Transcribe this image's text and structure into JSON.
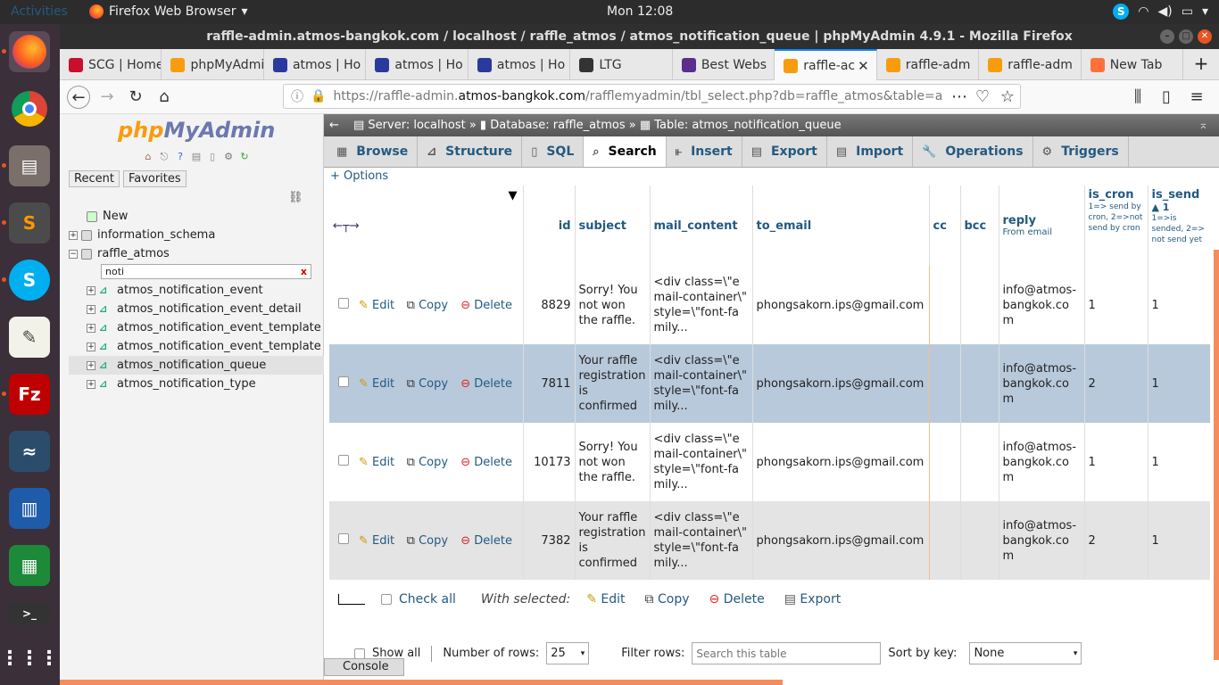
{
  "topbar": {
    "activities": "Activities",
    "app": "Firefox Web Browser",
    "clock": "Mon 12:08"
  },
  "window": {
    "title": "raffle-admin.atmos-bangkok.com / localhost / raffle_atmos / atmos_notification_queue | phpMyAdmin 4.9.1 - Mozilla Firefox"
  },
  "tabs": [
    {
      "label": "SCG | Home",
      "icon": "scg-icon",
      "color": "#c8102e"
    },
    {
      "label": "phpMyAdmin",
      "icon": "pma-icon",
      "color": "#f89c0e"
    },
    {
      "label": "atmos | Ho",
      "icon": "atmos-icon",
      "color": "#2a3a9c"
    },
    {
      "label": "atmos | Ho",
      "icon": "atmos-icon",
      "color": "#2a3a9c"
    },
    {
      "label": "atmos | Ho",
      "icon": "atmos-icon",
      "color": "#2a3a9c"
    },
    {
      "label": "LTG",
      "icon": "ltg-icon",
      "color": "#333"
    },
    {
      "label": "Best Webs",
      "icon": "best-icon",
      "color": "#5b2d8c"
    },
    {
      "label": "raffle-ac",
      "icon": "pma-icon",
      "color": "#f89c0e",
      "active": true
    },
    {
      "label": "raffle-adm",
      "icon": "pma-icon",
      "color": "#f89c0e"
    },
    {
      "label": "raffle-adm",
      "icon": "pma-icon",
      "color": "#f89c0e"
    },
    {
      "label": "New Tab",
      "icon": "firefox-icon",
      "color": "#ff7139"
    }
  ],
  "url": {
    "prefix": "https://raffle-admin.",
    "domain": "atmos-bangkok.com",
    "path": "/rafflemyadmin/tbl_select.php?db=raffle_atmos&table=a"
  },
  "sidebar": {
    "logo_a": "php",
    "logo_b": "MyAdmin",
    "recent": "Recent",
    "favorites": "Favorites",
    "new": "New",
    "db1": "information_schema",
    "db2": "raffle_atmos",
    "filter": "noti",
    "filter_clear": "x",
    "tables": [
      "atmos_notification_event",
      "atmos_notification_event_detail",
      "atmos_notification_event_template",
      "atmos_notification_event_template",
      "atmos_notification_queue",
      "atmos_notification_type"
    ],
    "selected_index": 4
  },
  "breadcrumb": {
    "server": "Server: localhost",
    "database": "Database: raffle_atmos",
    "table": "Table: atmos_notification_queue"
  },
  "menu": [
    "Browse",
    "Structure",
    "SQL",
    "Search",
    "Insert",
    "Export",
    "Import",
    "Operations",
    "Triggers"
  ],
  "active_menu": "Search",
  "options": "+ Options",
  "columns": {
    "id": "id",
    "subject": "subject",
    "mail_content": "mail_content",
    "to_email": "to_email",
    "cc": "cc",
    "bcc": "bcc",
    "reply": "reply",
    "reply_sub": "From email",
    "is_cron": "is_cron",
    "is_cron_sub": "1=> send by cron, 2=>not send by cron",
    "is_send": "is_send",
    "is_send_num": "1",
    "is_send_sub": "1=>is sended, 2=> not send yet"
  },
  "actions": {
    "edit": "Edit",
    "copy": "Copy",
    "delete": "Delete"
  },
  "rows": [
    {
      "id": "8829",
      "subject": "Sorry! You not won the raffle.",
      "mail": "<div class=\\\"email-container\\\" style=\\\"font-family...",
      "to": "phongsakorn.ips@gmail.com",
      "reply": "info@atmos-bangkok.com",
      "cron": "1",
      "send": "1"
    },
    {
      "id": "7811",
      "subject": "Your raffle registration is confirmed",
      "mail": "<div class=\\\"email-container\\\" style=\\\"font-family...",
      "to": "phongsakorn.ips@gmail.com",
      "reply": "info@atmos-bangkok.com",
      "cron": "2",
      "send": "1"
    },
    {
      "id": "10173",
      "subject": "Sorry! You not won the raffle.",
      "mail": "<div class=\\\"email-container\\\" style=\\\"font-family...",
      "to": "phongsakorn.ips@gmail.com",
      "reply": "info@atmos-bangkok.com",
      "cron": "1",
      "send": "1"
    },
    {
      "id": "7382",
      "subject": "Your raffle registration is confirmed",
      "mail": "<div class=\\\"email-container\\\" style=\\\"font-family...",
      "to": "phongsakorn.ips@gmail.com",
      "reply": "info@atmos-bangkok.com",
      "cron": "2",
      "send": "1"
    }
  ],
  "bottom": {
    "check_all": "Check all",
    "with_selected": "With selected:",
    "edit": "Edit",
    "copy": "Copy",
    "delete": "Delete",
    "export": "Export"
  },
  "nav": {
    "show_all": "Show all",
    "num_rows_label": "Number of rows:",
    "num_rows": "25",
    "filter_label": "Filter rows:",
    "filter_placeholder": "Search this table",
    "sort_label": "Sort by key:",
    "sort_value": "None"
  },
  "console": "Console"
}
